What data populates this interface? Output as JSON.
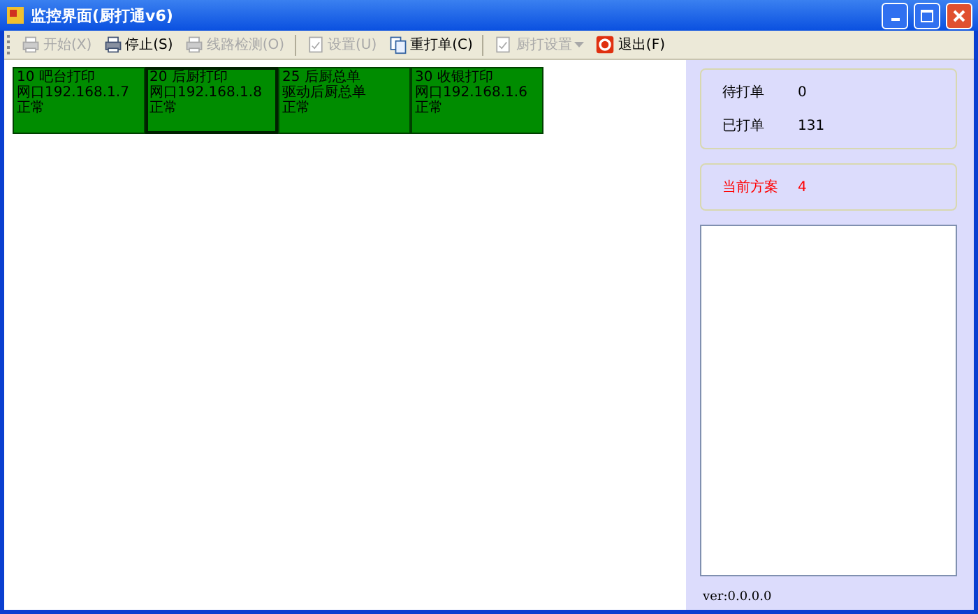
{
  "window": {
    "title": "监控界面(厨打通v6)"
  },
  "toolbar": [
    {
      "label": "开始(X)",
      "kind": "start",
      "disabled": true,
      "dropdown": false
    },
    {
      "label": "停止(S)",
      "kind": "stop",
      "disabled": false,
      "dropdown": false
    },
    {
      "label": "线路检测(O)",
      "kind": "check",
      "disabled": true,
      "dropdown": false
    },
    {
      "kind": "separator"
    },
    {
      "label": "设置(U)",
      "kind": "settings",
      "disabled": true,
      "dropdown": false
    },
    {
      "label": "重打单(C)",
      "kind": "reprint",
      "disabled": false,
      "dropdown": false
    },
    {
      "kind": "separator"
    },
    {
      "label": "厨打设置",
      "kind": "kitchen",
      "disabled": true,
      "dropdown": true
    },
    {
      "label": "退出(F)",
      "kind": "exit",
      "disabled": false,
      "dropdown": false
    }
  ],
  "printers": [
    {
      "name": "10 吧台打印",
      "address": "网口192.168.1.7",
      "status": "正常",
      "selected": false
    },
    {
      "name": "20 后厨打印",
      "address": "网口192.168.1.8",
      "status": "正常",
      "selected": true
    },
    {
      "name": "25 后厨总单",
      "address": "驱动后厨总单",
      "status": "正常",
      "selected": false
    },
    {
      "name": "30 收银打印",
      "address": "网口192.168.1.6",
      "status": "正常",
      "selected": false
    }
  ],
  "stats": [
    {
      "label": "待打单",
      "value": "0"
    },
    {
      "label": "已打单",
      "value": "131"
    }
  ],
  "plan": {
    "label": "当前方案",
    "value": "4"
  },
  "version": "ver:0.0.0.0"
}
